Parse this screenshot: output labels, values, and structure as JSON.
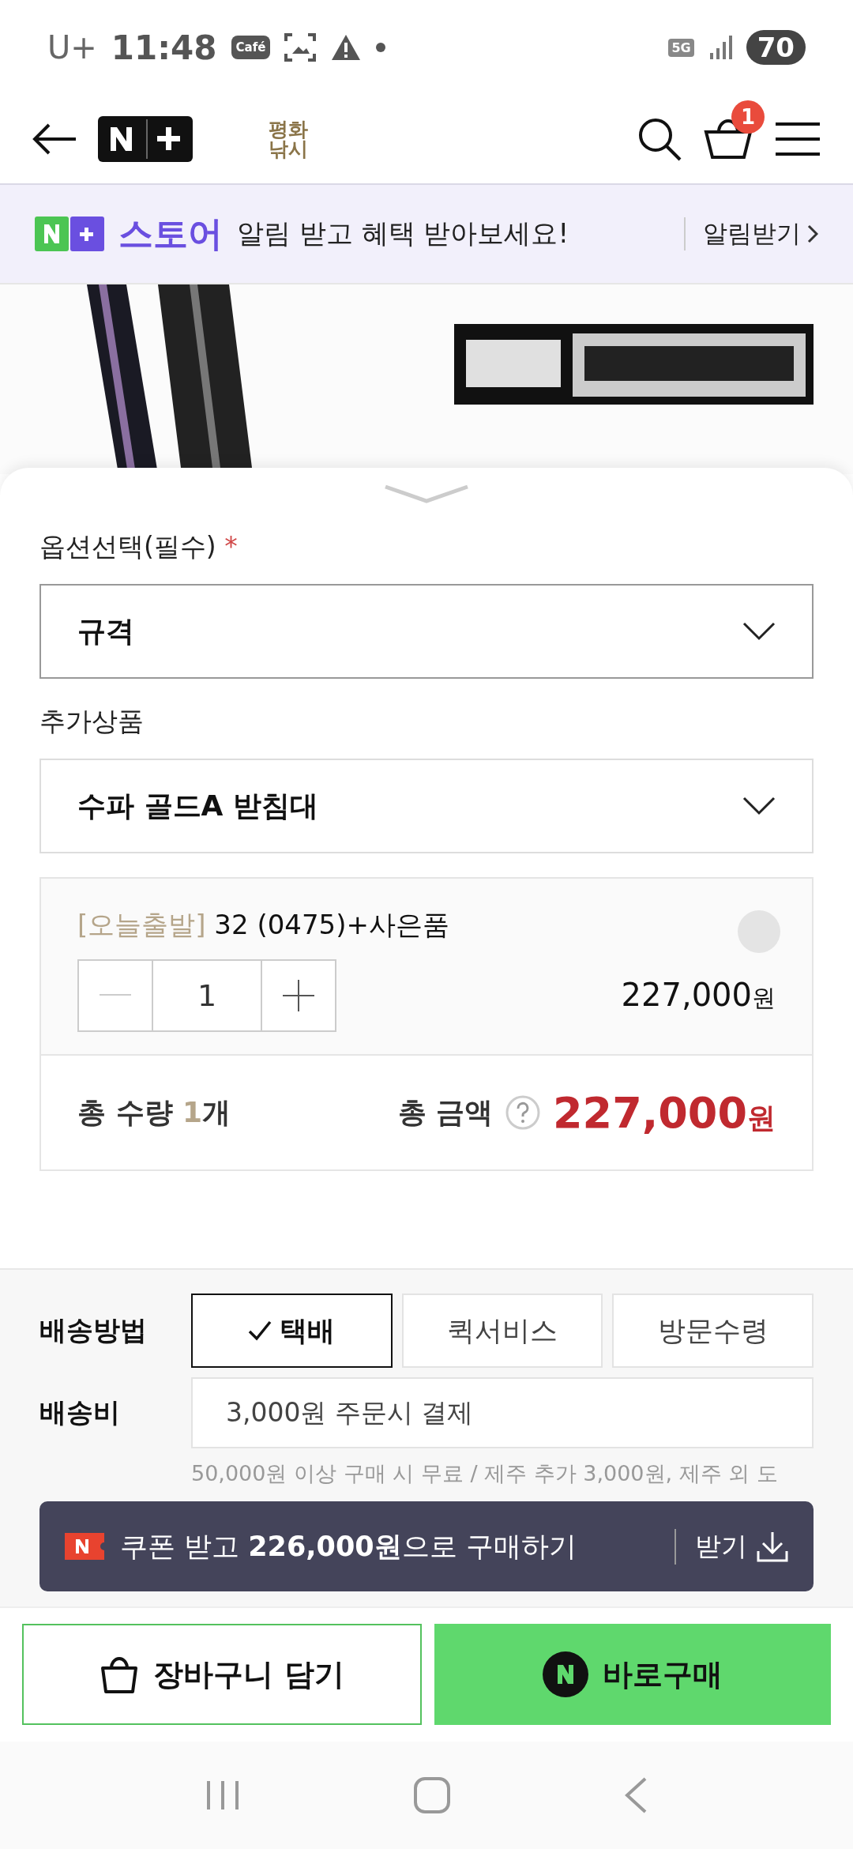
{
  "status_bar": {
    "carrier": "U+",
    "time": "11:48",
    "notification_badge": "Café",
    "network": "5G",
    "battery": "70"
  },
  "header": {
    "store_logo": "평화\n낚시",
    "cart_count": "1"
  },
  "banner": {
    "brand": "스토어",
    "message": "알림 받고 혜택 받아보세요!",
    "action": "알림받기"
  },
  "options": {
    "label": "옵션선택(필수)",
    "required_mark": "*",
    "select": "규격"
  },
  "addons": {
    "label": "추가상품",
    "select": "수파 골드A 받침대"
  },
  "selected_item": {
    "tag": "[오늘출발]",
    "name": "32 (0475)+사은품",
    "quantity": "1",
    "price": "227,000",
    "price_unit": "원"
  },
  "totals": {
    "quantity_label": "총 수량",
    "quantity": "1",
    "quantity_unit": "개",
    "amount_label": "총 금액",
    "amount": "227,000",
    "amount_unit": "원"
  },
  "delivery": {
    "label": "배송방법",
    "methods": [
      {
        "label": "택배",
        "selected": true
      },
      {
        "label": "퀵서비스",
        "selected": false
      },
      {
        "label": "방문수령",
        "selected": false
      }
    ]
  },
  "shipping_fee": {
    "label": "배송비",
    "value": "3,000원 주문시 결제",
    "note": "50,000원 이상 구매 시 무료 / 제주 추가 3,000원, 제주 외 도"
  },
  "coupon": {
    "message": "쿠폰 받고 **226,000원**으로 구매하기",
    "action": "받기"
  },
  "actions": {
    "cart": "장바구니 담기",
    "buy": "바로구매"
  }
}
